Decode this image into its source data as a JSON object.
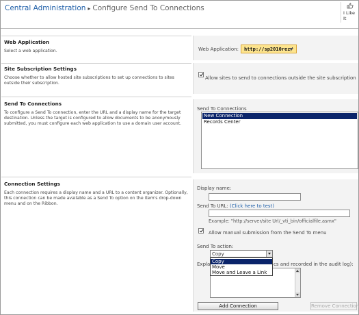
{
  "header": {
    "site": "Central Administration",
    "separator": "▸",
    "page_title": "Configure Send To Connections",
    "like_label": "I Like It"
  },
  "sections": {
    "web_application": {
      "title": "Web Application",
      "description": "Select a web application.",
      "field_label": "Web Application:",
      "selected": "http://sp2010rez/"
    },
    "site_subscription": {
      "title": "Site Subscription Settings",
      "description": "Choose whether to allow hosted site subscriptions to set up connections to sites outside their subscription.",
      "checkbox_label": "Allow sites to send to connections outside the site subscription",
      "checked": true
    },
    "send_to_connections": {
      "title": "Send To Connections",
      "description": "To configure a Send To connection, enter the URL and a display name for the target destination. Unless the target is configured to allow documents to be anonymously submitted, you must configure each web application to use a domain user account.",
      "list_label": "Send To Connections",
      "items": [
        "New Connection",
        "Records Center"
      ],
      "selected_index": 0
    },
    "connection_settings": {
      "title": "Connection Settings",
      "description": "Each connection requires a display name and a URL to a content organizer. Optionally, this connection can be made available as a Send To option on the item's drop-down menu and on the Ribbon.",
      "display_name_label": "Display name:",
      "display_name_value": "",
      "url_label": "Send To URL:",
      "url_link": "(Click here to test)",
      "url_value": "",
      "example": "Example: \"http://server/site Url/_vti_bin/officialfile.asmx\"",
      "manual_checkbox_label": "Allow manual submission from the Send To menu",
      "manual_checked": true,
      "action_label": "Send To action:",
      "action_selected": "Copy",
      "action_options": [
        "Copy",
        "Move",
        "Move and Leave a Link"
      ],
      "action_highlighted_index": 0,
      "explanation_prefix": "Expla",
      "explanation_suffix": "cs and recorded in the audit log):",
      "add_button": "Add Connection",
      "remove_button": "Remove Connection"
    }
  },
  "colors": {
    "link": "#1f5fa8",
    "selection": "#0a246a",
    "webapp_button": "#fde48e",
    "panel": "#f3f3f3"
  }
}
